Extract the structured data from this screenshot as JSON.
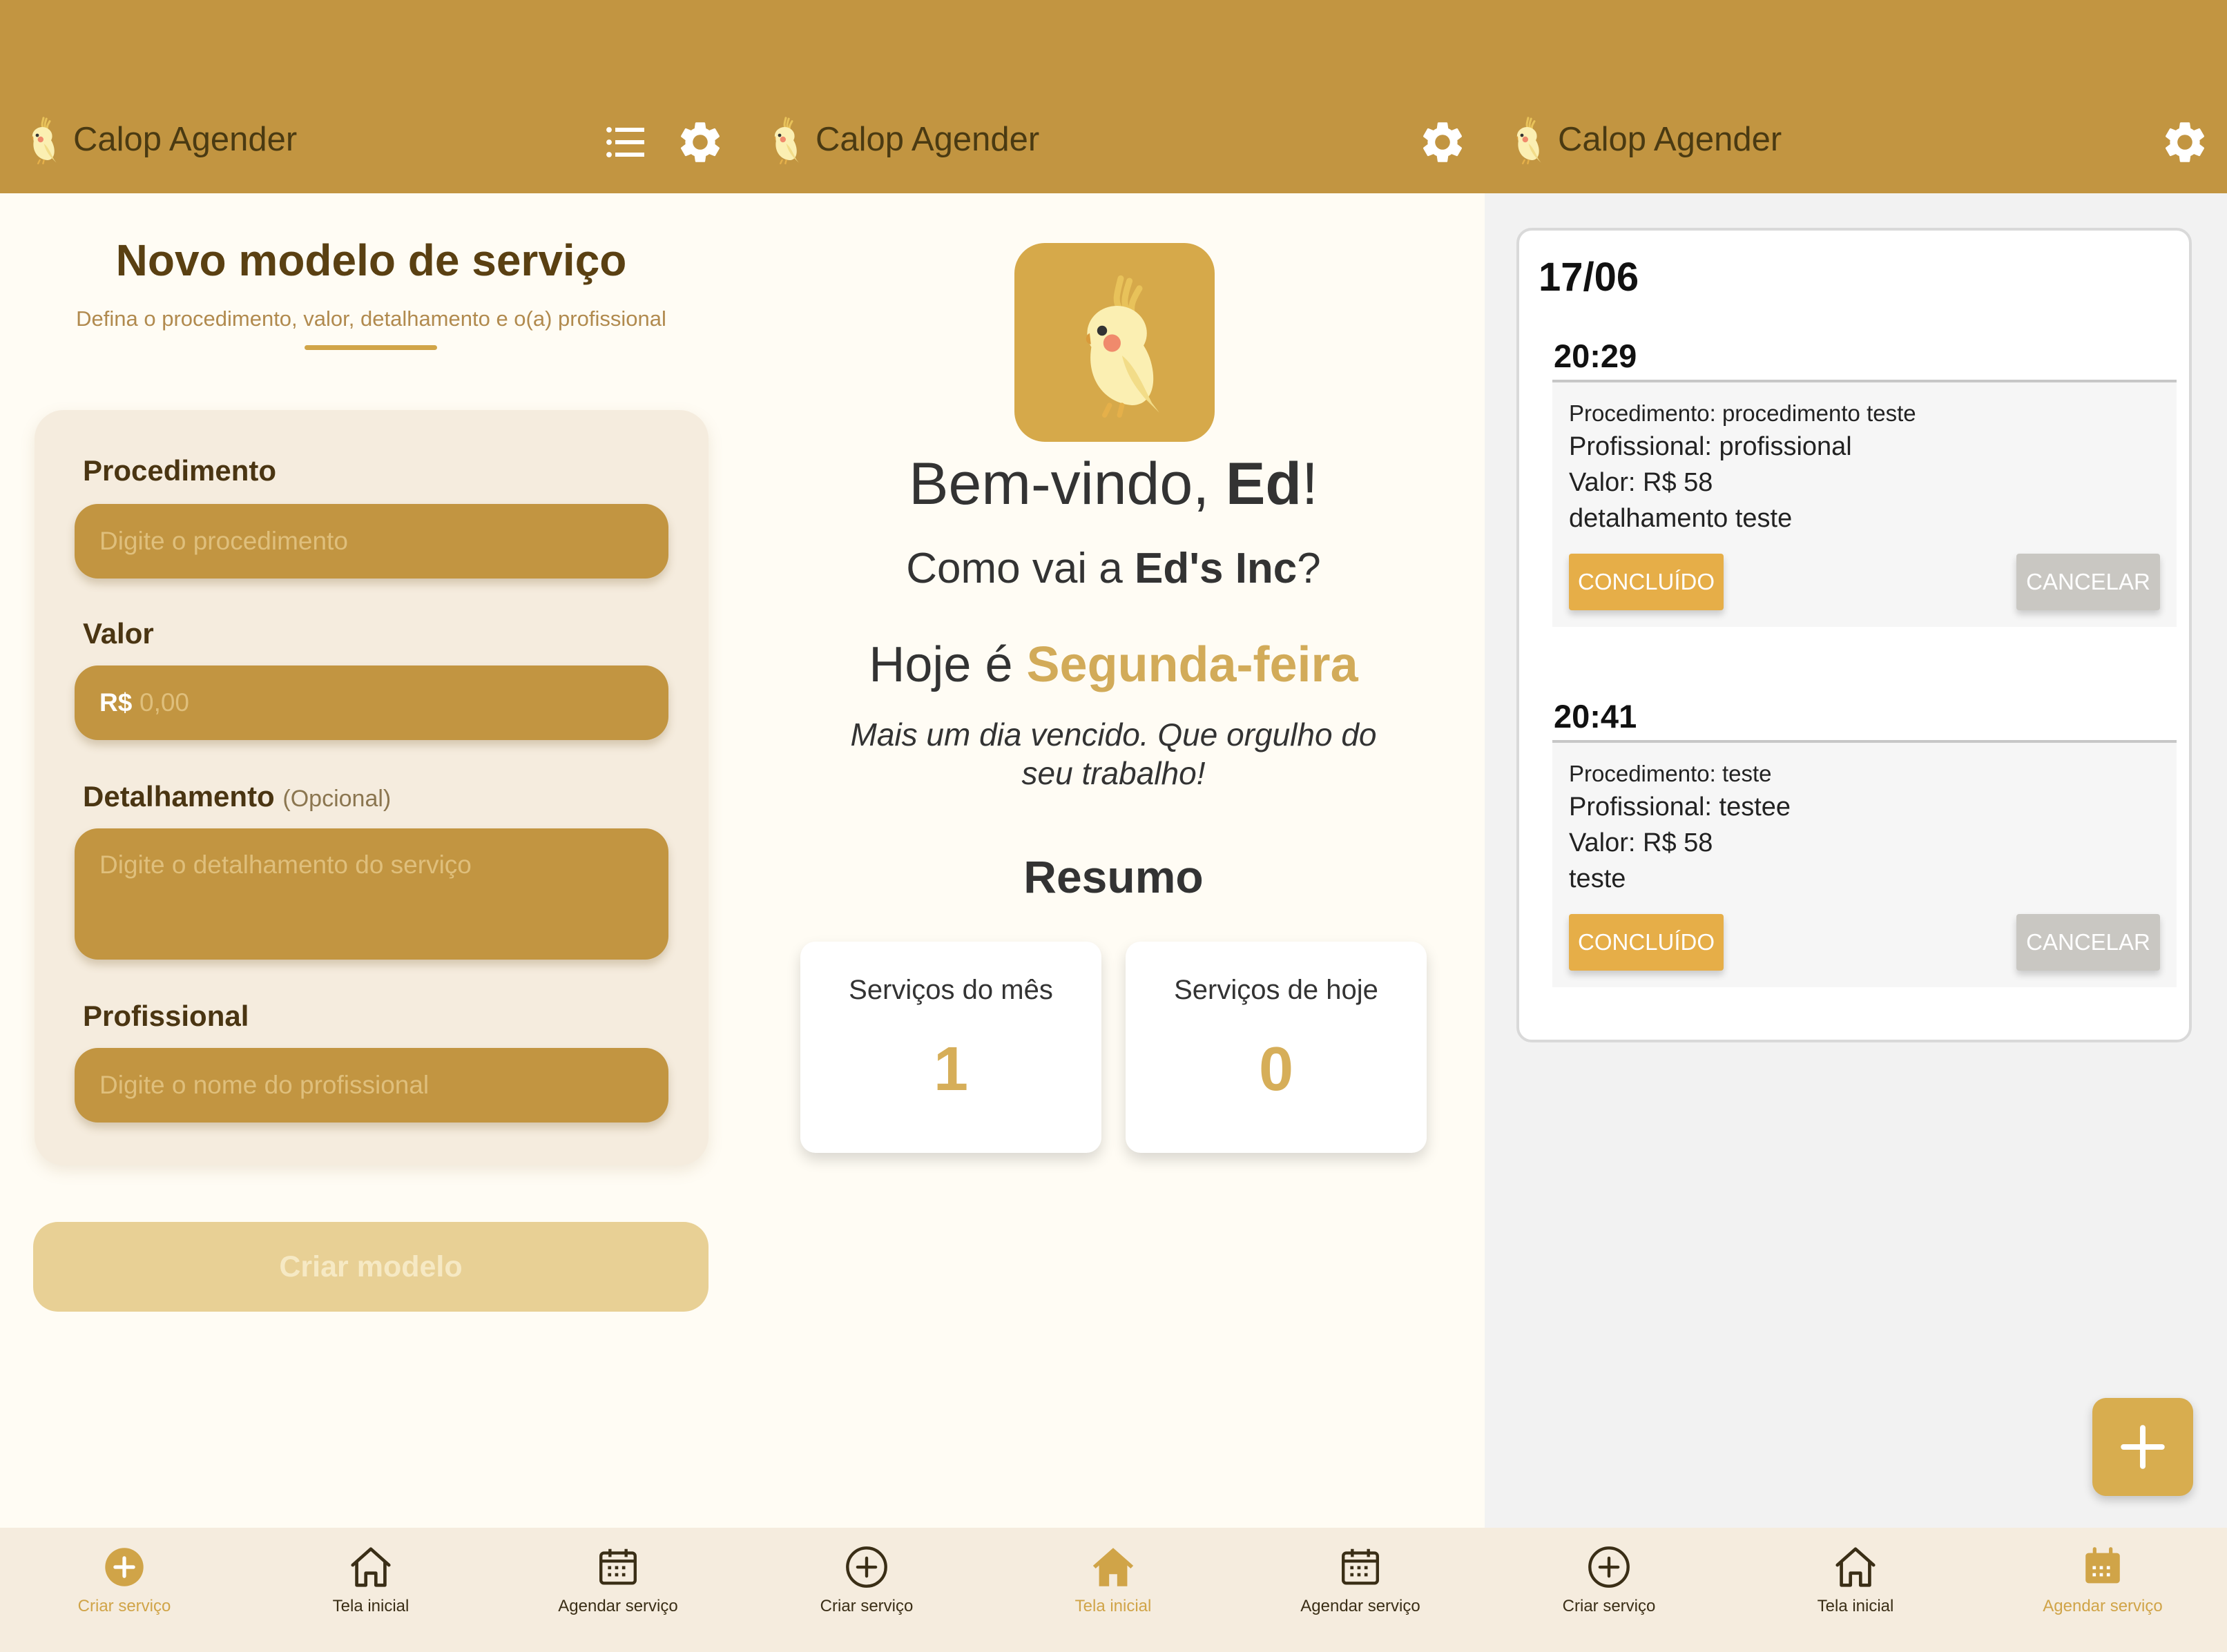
{
  "app": {
    "title": "Calop Agender"
  },
  "nav": {
    "create": "Criar serviço",
    "home": "Tela inicial",
    "schedule": "Agendar serviço"
  },
  "new_model": {
    "title": "Novo modelo de serviço",
    "subtitle": "Defina o procedimento, valor, detalhamento e o(a) profissional",
    "procedure_label": "Procedimento",
    "procedure_placeholder": "Digite o procedimento",
    "value_label": "Valor",
    "currency": "R$",
    "value_placeholder": "0,00",
    "detail_label": "Detalhamento",
    "detail_optional": "(Opcional)",
    "detail_placeholder": "Digite o detalhamento do serviço",
    "professional_label": "Profissional",
    "professional_placeholder": "Digite o nome do profissional",
    "create_button": "Criar modelo"
  },
  "home": {
    "welcome_prefix": "Bem-vindo, ",
    "user_name": "Ed",
    "welcome_suffix": "!",
    "company_prefix": "Como vai a ",
    "company_name": "Ed's Inc",
    "company_suffix": "?",
    "today_prefix": "Hoje é ",
    "today_day": "Segunda-feira",
    "quote": "Mais um dia vencido. Que orgulho do seu trabalho!",
    "summary_title": "Resumo",
    "month_label": "Serviços do mês",
    "month_value": "1",
    "today_label": "Serviços de hoje",
    "today_value": "0"
  },
  "schedule": {
    "date": "17/06",
    "appointments": [
      {
        "time": "20:29",
        "procedure": "Procedimento: procedimento teste",
        "professional": "Profissional: profissional",
        "value": "Valor: R$ 58",
        "detail": "detalhamento teste",
        "done_label": "CONCLUÍDO",
        "cancel_label": "CANCELAR"
      },
      {
        "time": "20:41",
        "procedure": "Procedimento: teste",
        "professional": "Profissional: testee",
        "value": "Valor: R$ 58",
        "detail": "teste",
        "done_label": "CONCLUÍDO",
        "cancel_label": "CANCELAR"
      }
    ]
  },
  "colors": {
    "primary": "#c29541",
    "accent": "#d6ae59",
    "button_done": "#e6ae48",
    "button_cancel": "#c9c7c2",
    "surface": "#f5ecde"
  },
  "icons": {
    "logo": "cockatiel-logo-icon",
    "list": "list-icon",
    "settings": "gear-icon",
    "create": "plus-circle-icon",
    "home": "home-icon",
    "schedule": "calendar-icon",
    "fab": "plus-icon"
  }
}
